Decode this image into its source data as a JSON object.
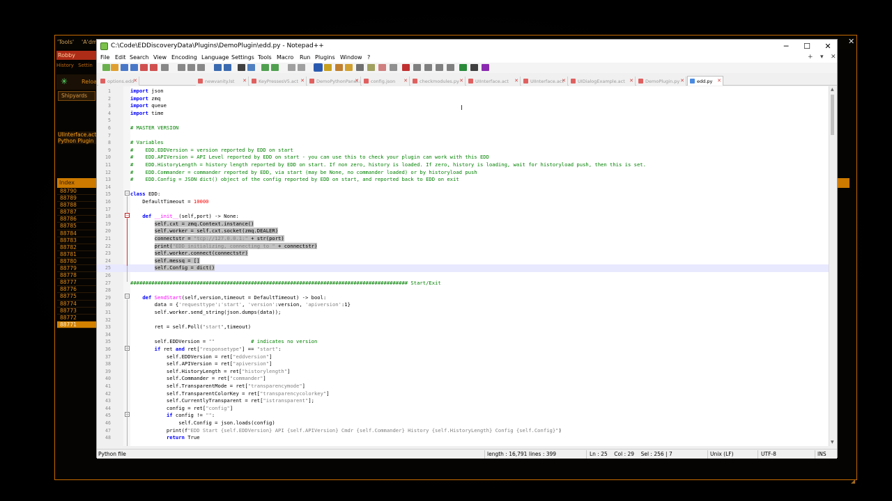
{
  "background_app": {
    "top_labels": [
      "'Tools'",
      "'A'dm"
    ],
    "commander": "Robby",
    "history_tabs": [
      "History",
      "Settin"
    ],
    "reload_label": "Reloa",
    "shipyards_button": "Shipyards",
    "panel_list": [
      "UIInterface.act",
      "Python Plugin"
    ],
    "table_header": "Index",
    "table_rows": [
      "88790",
      "88789",
      "88788",
      "88787",
      "88786",
      "88785",
      "88784",
      "88783",
      "88782",
      "88781",
      "88780",
      "88779",
      "88778",
      "88777",
      "88776",
      "88775",
      "88774",
      "88773",
      "88772",
      "88771"
    ],
    "selected_row": "88771"
  },
  "window": {
    "title": "C:\\Code\\EDDiscoveryData\\Plugins\\DemoPlugin\\edd.py - Notepad++",
    "minimize": "─",
    "maximize": "☐",
    "close": "✕"
  },
  "menu": [
    "File",
    "Edit",
    "Search",
    "View",
    "Encoding",
    "Language",
    "Settings",
    "Tools",
    "Macro",
    "Run",
    "Plugins",
    "Window",
    "?"
  ],
  "menu_right": [
    "+",
    "▾",
    "✕"
  ],
  "tabs": [
    {
      "label": "options.edd",
      "active": false
    },
    {
      "label": "newvanity.lst",
      "active": false
    },
    {
      "label": "KeyPressesV5.act",
      "active": false
    },
    {
      "label": "DemoPythonPanel.act",
      "active": false
    },
    {
      "label": "config.json",
      "active": false
    },
    {
      "label": "checkmodules.py",
      "active": false
    },
    {
      "label": "UIInterface.act",
      "active": false
    },
    {
      "label": "UIInterface.act",
      "active": false
    },
    {
      "label": "UIDialogExample.act",
      "active": false
    },
    {
      "label": "DemoPlugin.py",
      "active": false
    },
    {
      "label": "edd.py",
      "active": true
    }
  ],
  "code_lines": [
    {
      "n": "1",
      "html": "<span class=\"kw\">import</span> json"
    },
    {
      "n": "2",
      "html": "<span class=\"kw\">import</span> zmq"
    },
    {
      "n": "3",
      "html": "<span class=\"kw\">import</span> queue"
    },
    {
      "n": "4",
      "html": "<span class=\"kw\">import</span> time"
    },
    {
      "n": "5",
      "html": ""
    },
    {
      "n": "6",
      "html": "<span class=\"cm\"># MASTER VERSION</span>"
    },
    {
      "n": "7",
      "html": ""
    },
    {
      "n": "8",
      "html": "<span class=\"cm\"># Variables</span>"
    },
    {
      "n": "9",
      "html": "<span class=\"cm\">#    EDD.EDDVersion = version reported by EDD on start</span>"
    },
    {
      "n": "10",
      "html": "<span class=\"cm\">#    EDD.APIVersion = API Level reported by EDD on start - you can use this to check your plugin can work with this EDD</span>"
    },
    {
      "n": "11",
      "html": "<span class=\"cm\">#    EDD.HistoryLength = history length reported by EDD on start. If non zero, history is loaded. If zero, history is loading, wait for historyload push, then this is set.</span>"
    },
    {
      "n": "12",
      "html": "<span class=\"cm\">#    EDD.Commander = commander reported by EDD, via start (may be None, no commander loaded) or by historyload push</span>"
    },
    {
      "n": "13",
      "html": "<span class=\"cm\">#    EDD.Config = JSON dict() object of the config reported by EDD on start, and reported back to EDD on exit</span>"
    },
    {
      "n": "14",
      "html": ""
    },
    {
      "n": "15",
      "html": "<span class=\"kw\">class</span> EDD:"
    },
    {
      "n": "16",
      "html": "    DefaultTimeout = <span class=\"nm\">10000</span>"
    },
    {
      "n": "17",
      "html": ""
    },
    {
      "n": "18",
      "html": "    <span class=\"kw\">def</span> <span class=\"fn\">__init__</span>(self,port) -&gt; None:"
    },
    {
      "n": "19",
      "html": "        <span class=\"sel\">self.cxt = zmq.Context.instance()</span>"
    },
    {
      "n": "20",
      "html": "        <span class=\"sel\">self.worker = self.cxt.socket(zmq.DEALER)</span>"
    },
    {
      "n": "21",
      "html": "        <span class=\"sel\">connectstr = <span class=\"st\">\"tcp://127.0.0.1:\"</span> + str(port)</span>"
    },
    {
      "n": "22",
      "html": "        <span class=\"sel\">print(<span class=\"st\">\"EDD initializing, connecting to \"</span> + connectstr)</span>"
    },
    {
      "n": "23",
      "html": "        <span class=\"sel\">self.worker.connect(connectstr)</span>"
    },
    {
      "n": "24",
      "html": "        <span class=\"sel\">self.messq = []</span>"
    },
    {
      "n": "25",
      "html": "        <span class=\"sel\">self.Config = dict()</span>"
    },
    {
      "n": "26",
      "html": ""
    },
    {
      "n": "27",
      "html": "<span class=\"cm\">############################################################################################ Start/Exit</span>"
    },
    {
      "n": "28",
      "html": ""
    },
    {
      "n": "29",
      "html": "    <span class=\"kw\">def</span> <span class=\"fn\">SendStart</span>(self,version,timeout = DefaultTimeout) -&gt; bool:"
    },
    {
      "n": "30",
      "html": "        data = {<span class=\"st\">'requesttype'</span>:<span class=\"st\">'start'</span>, <span class=\"st\">'version'</span>:version, <span class=\"st\">'apiversion'</span>:1}"
    },
    {
      "n": "31",
      "html": "        self.worker.send_string(json.dumps(data));"
    },
    {
      "n": "32",
      "html": ""
    },
    {
      "n": "33",
      "html": "        ret = self.Poll(<span class=\"st\">\"start\"</span>,timeout)"
    },
    {
      "n": "34",
      "html": ""
    },
    {
      "n": "35",
      "html": "        self.EDDVersion = <span class=\"st\">\"\"</span>            <span class=\"cm\"># indicates no version</span>"
    },
    {
      "n": "36",
      "html": "        <span class=\"kw\">if</span> ret <span class=\"kw\">and</span> ret[<span class=\"st\">\"responsetype\"</span>] == <span class=\"st\">\"start\"</span>:"
    },
    {
      "n": "37",
      "html": "            self.EDDVersion = ret[<span class=\"st\">\"eddversion\"</span>]"
    },
    {
      "n": "38",
      "html": "            self.APIVersion = ret[<span class=\"st\">\"apiversion\"</span>]"
    },
    {
      "n": "39",
      "html": "            self.HistoryLength = ret[<span class=\"st\">\"historylength\"</span>]"
    },
    {
      "n": "40",
      "html": "            self.Commander = ret[<span class=\"st\">\"commander\"</span>]"
    },
    {
      "n": "41",
      "html": "            self.TransparentMode = ret[<span class=\"st\">\"transparencymode\"</span>]"
    },
    {
      "n": "42",
      "html": "            self.TransparentColorKey = ret[<span class=\"st\">\"transparencycolorkey\"</span>]"
    },
    {
      "n": "43",
      "html": "            self.CurrentlyTransparent = ret[<span class=\"st\">\"istransparent\"</span>];"
    },
    {
      "n": "44",
      "html": "            config = ret[<span class=\"st\">\"config\"</span>]"
    },
    {
      "n": "45",
      "html": "            <span class=\"kw\">if</span> config != <span class=\"st\">\"\"</span>:"
    },
    {
      "n": "46",
      "html": "                self.Config = json.loads(config)"
    },
    {
      "n": "47",
      "html": "            print(f<span class=\"st\">\"EDD Start {self.EDDVersion} API {self.APIVersion} Cmdr {self.Commander} History {self.HistoryLength} Config {self.Config}\"</span>)"
    },
    {
      "n": "48",
      "html": "            <span class=\"kw\">return</span> True"
    }
  ],
  "status": {
    "file_type": "Python file",
    "length": "length : 16,791",
    "lines": "lines : 399",
    "position": "Ln : 25    Col : 29    Sel : 256 | 7",
    "eol": "Unix (LF)",
    "encoding": "UTF-8",
    "mode": "INS"
  },
  "colors": {
    "edd_accent": "#cc7a00",
    "keyword": "#0000ff",
    "comment": "#008000",
    "string": "#808080",
    "number": "#ff0000",
    "function": "#ff00ff"
  }
}
